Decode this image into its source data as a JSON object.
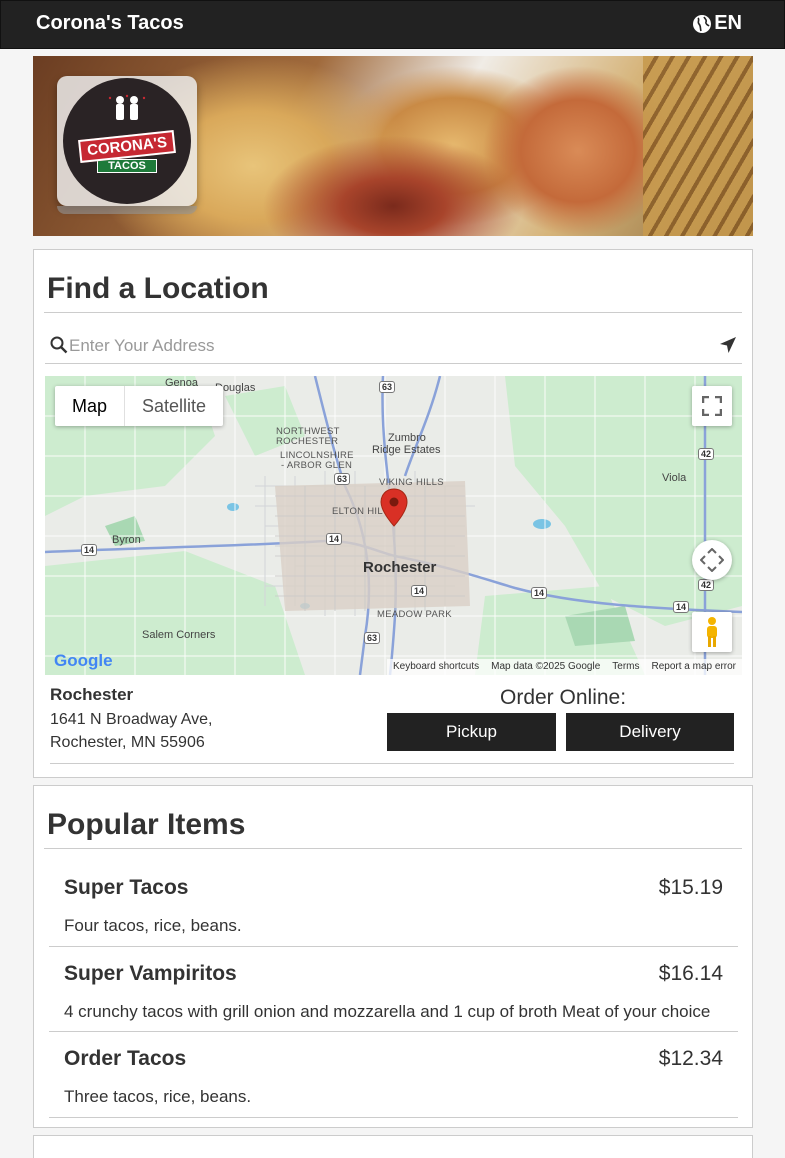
{
  "header": {
    "brand": "Corona's Tacos",
    "language": "EN"
  },
  "logo": {
    "name": "CORONA'S",
    "sub": "TACOS"
  },
  "locator": {
    "title": "Find a Location",
    "search_placeholder": "Enter Your Address",
    "map": {
      "type_buttons": [
        "Map",
        "Satellite"
      ],
      "places": {
        "genoa": "Genoa",
        "douglas": "Douglas",
        "nw_rochester_1": "NORTHWEST",
        "nw_rochester_2": "ROCHESTER",
        "lincolnshire_1": "LINCOLNSHIRE",
        "lincolnshire_2": "- ARBOR GLEN",
        "zumbro_1": "Zumbro",
        "zumbro_2": "Ridge Estates",
        "viking_hills": "VIKING HILLS",
        "elton_hills": "ELTON HIL",
        "viola": "Viola",
        "byron": "Byron",
        "rochester": "Rochester",
        "meadow_park": "MEADOW PARK",
        "salem_corners": "Salem Corners"
      },
      "shields": [
        "63",
        "63",
        "42",
        "14",
        "14",
        "42",
        "14",
        "14",
        "14",
        "63"
      ],
      "google": "Google",
      "attribution": [
        "Keyboard shortcuts",
        "Map data ©2025 Google",
        "Terms",
        "Report a map error"
      ]
    },
    "location": {
      "name": "Rochester",
      "address_line1": "1641 N Broadway Ave,",
      "address_line2": "Rochester, MN 55906"
    },
    "order": {
      "label": "Order Online:",
      "pickup": "Pickup",
      "delivery": "Delivery"
    }
  },
  "popular": {
    "title": "Popular Items",
    "items": [
      {
        "name": "Super Tacos",
        "price": "$15.19",
        "description": "Four tacos, rice, beans."
      },
      {
        "name": "Super Vampiritos",
        "price": "$16.14",
        "description": "4 crunchy tacos with grill onion and mozzarella and 1 cup of broth Meat of your choice"
      },
      {
        "name": "Order Tacos",
        "price": "$12.34",
        "description": "Three tacos, rice, beans."
      }
    ]
  },
  "colors": {
    "header_bg": "#222222",
    "button_bg": "#222222",
    "map_pin": "#d93025",
    "map_green": "#cdeccf"
  }
}
